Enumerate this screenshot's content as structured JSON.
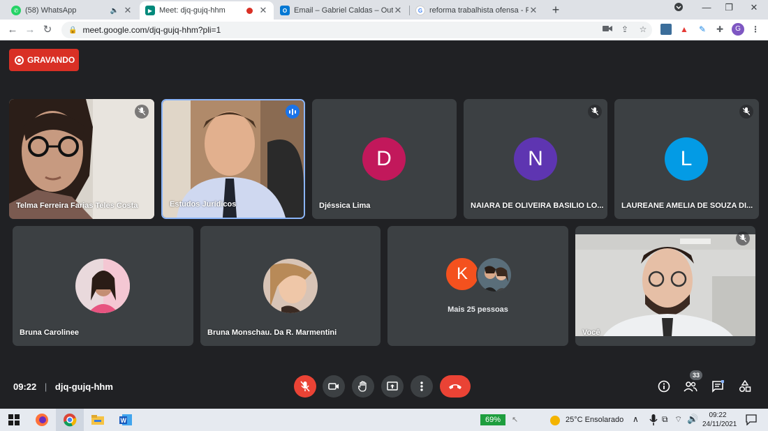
{
  "browser": {
    "tabs": [
      {
        "label": "(58) WhatsApp",
        "icon": "whatsapp-icon"
      },
      {
        "label": "Meet: djq-gujq-hhm",
        "icon": "meet-icon"
      },
      {
        "label": "Email – Gabriel Caldas – Outlook",
        "icon": "outlook-icon"
      },
      {
        "label": "reforma trabalhista ofensa - Pesq",
        "icon": "google-icon"
      }
    ],
    "url": "meet.google.com/djq-gujq-hhm?pli=1",
    "profile_initial": "G"
  },
  "meet": {
    "recording_label": "GRAVANDO",
    "participants": [
      {
        "name": "Telma Ferreira Farias Teles Costa",
        "muted": true
      },
      {
        "name": "Estudos Jurídicos",
        "speaking": true
      },
      {
        "name": "Djéssica Lima",
        "initial": "D",
        "color": "#c2185b"
      },
      {
        "name": "NAIARA DE OLIVEIRA BASILIO LO...",
        "initial": "N",
        "color": "#5e35b1",
        "muted": true
      },
      {
        "name": "LAUREANE AMELIA DE SOUZA DI...",
        "initial": "L",
        "color": "#039be5",
        "muted": true
      },
      {
        "name": "Bruna Carolinee"
      },
      {
        "name": "Bruna Monschau. Da R. Marmentini"
      },
      {
        "name": "Mais 25 pessoas",
        "initial": "K",
        "color": "#f4511e"
      },
      {
        "name": "Você",
        "muted": true
      }
    ],
    "time": "09:22",
    "meeting_code": "djq-gujq-hhm",
    "participant_count": "33"
  },
  "taskbar": {
    "battery": "69%",
    "weather": "25°C  Ensolarado",
    "time": "09:22",
    "date": "24/11/2021"
  }
}
